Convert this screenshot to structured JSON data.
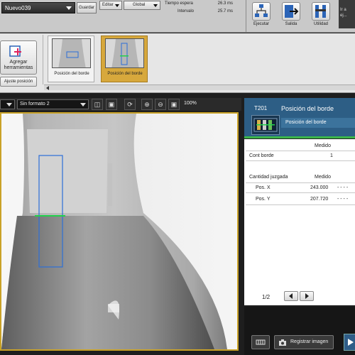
{
  "topbar": {
    "scene_name": "Nuevo039",
    "save_label": "Guardar",
    "edit_label": "Editar",
    "scope_label": "Global",
    "wait_label": "Tiempo espera",
    "wait_value": "26.3 ms",
    "interval_label": "Intervalo",
    "interval_value": "25.7 ms",
    "run_label": "Ejecutar",
    "output_label": "Salida",
    "utility_label": "Utilidad",
    "exec_text_1": "Ir a",
    "exec_text_2": "ej..."
  },
  "palette": {
    "add_tools_line1": "Agregar",
    "add_tools_line2": "herramientas",
    "adjust_label": "Ajuste posición",
    "tools": [
      {
        "label": "Posición del borde",
        "selected": false
      },
      {
        "label": "Posición del borde",
        "selected": true
      }
    ]
  },
  "image_toolbar": {
    "format_value": "Sin formato 2",
    "zoom": "100%"
  },
  "results": {
    "tool_id": "T201",
    "tool_name": "Posición del borde",
    "tool_sub": "Posición del borde",
    "col_measured": "Medido",
    "row1_label": "Cont borde",
    "row1_value": "1",
    "section_label": "Cantidad juzgada",
    "section_measured": "Medido",
    "pos_x_label": "Pos. X",
    "pos_x_value": "243.000",
    "pos_y_label": "Pos. Y",
    "pos_y_value": "207.720",
    "dashes": "- - - -",
    "page": "1/2"
  },
  "bottom": {
    "register_label": "Registrar imagen"
  },
  "colors": {
    "panel_blue": "#2d5e85",
    "edge_green": "#22d04b",
    "roi_blue": "#2c6fd8",
    "selected_gold": "#d7a83c"
  }
}
